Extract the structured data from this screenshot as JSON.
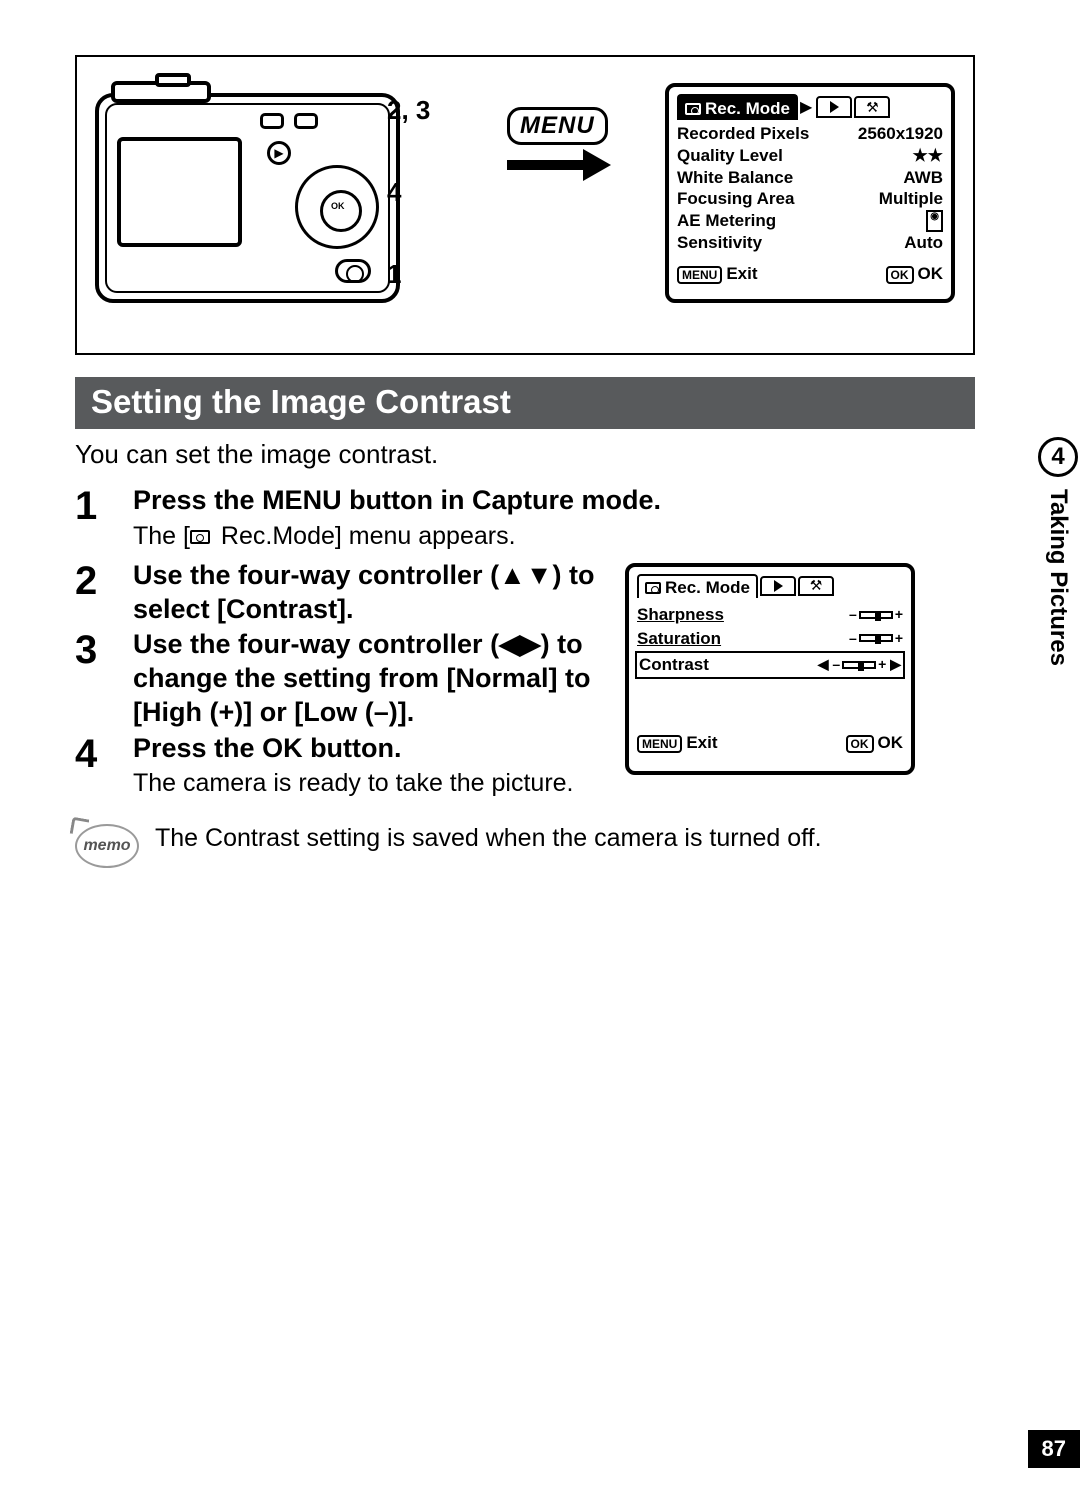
{
  "section_title": "Setting the Image Contrast",
  "intro": "You can set the image contrast.",
  "diagram": {
    "menu_label": "MENU",
    "callouts": {
      "a": "2, 3",
      "b": "4",
      "c": "1"
    }
  },
  "lcd_main": {
    "title": "Rec. Mode",
    "rows": [
      {
        "label": "Recorded Pixels",
        "value": "2560x1920"
      },
      {
        "label": "Quality Level",
        "value": "★★"
      },
      {
        "label": "White Balance",
        "value": "AWB"
      },
      {
        "label": "Focusing Area",
        "value": "Multiple"
      },
      {
        "label": "AE Metering",
        "value": ""
      },
      {
        "label": "Sensitivity",
        "value": "Auto"
      }
    ],
    "footer_left": "Exit",
    "footer_left_pill": "MENU",
    "footer_right": "OK",
    "footer_right_pill": "OK"
  },
  "steps": [
    {
      "num": "1",
      "heading": "Press the MENU button in Capture mode.",
      "sub_pre": "The [",
      "sub_post": " Rec.Mode] menu appears."
    },
    {
      "num": "2",
      "heading": "Use the four-way controller (▲▼) to select [Contrast]."
    },
    {
      "num": "3",
      "heading": "Use the four-way controller (◀▶) to change the setting from [Normal] to [High (+)] or [Low (–)]."
    },
    {
      "num": "4",
      "heading": "Press the OK button.",
      "sub": "The camera is ready to take the picture."
    }
  ],
  "lcd_contrast": {
    "title": "Rec. Mode",
    "rows": [
      {
        "label": "Sharpness"
      },
      {
        "label": "Saturation"
      },
      {
        "label": "Contrast",
        "selected": true
      }
    ],
    "footer_left": "Exit",
    "footer_left_pill": "MENU",
    "footer_right": "OK",
    "footer_right_pill": "OK"
  },
  "memo": {
    "icon": "memo",
    "text": "The Contrast setting is saved when the camera is turned off."
  },
  "side": {
    "chapter": "4",
    "title": "Taking Pictures"
  },
  "page_number": "87"
}
